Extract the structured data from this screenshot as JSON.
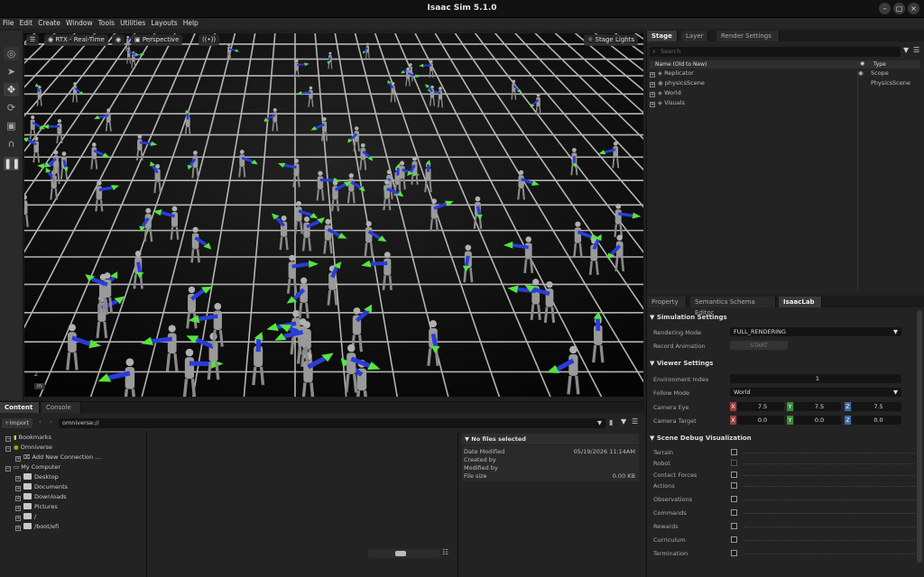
{
  "window": {
    "title": "Isaac Sim 5.1.0"
  },
  "menu": [
    "File",
    "Edit",
    "Create",
    "Window",
    "Tools",
    "Utilities",
    "Layouts",
    "Help"
  ],
  "viewport_toolbar": {
    "renderer": "RTX - Real-Time",
    "camera": "Perspective",
    "lights": "Stage Lights",
    "axis_label": "m"
  },
  "stage": {
    "tabs": [
      "Stage",
      "Layer",
      "Render Settings"
    ],
    "search_placeholder": "Search",
    "col_name": "Name (Old to New)",
    "col_type": "Type",
    "rows": [
      {
        "name": "Replicator",
        "type": "Scope"
      },
      {
        "name": "physicsScene",
        "type": "PhysicsScene"
      },
      {
        "name": "World",
        "type": ""
      },
      {
        "name": "Visuals",
        "type": ""
      }
    ]
  },
  "property": {
    "tabs": [
      "Property",
      "Semantics Schema Editor",
      "IsaacLab"
    ],
    "sim_settings": "Simulation Settings",
    "rendering_mode_label": "Rendering Mode",
    "rendering_mode_value": "FULL_RENDERING",
    "record_label": "Record Animation",
    "record_btn": "START",
    "viewer_settings": "Viewer Settings",
    "env_index_label": "Environment Index",
    "env_index_value": "1",
    "follow_label": "Follow Mode",
    "follow_value": "World",
    "cam_eye_label": "Camera Eye",
    "cam_eye": [
      "7.5",
      "7.5",
      "7.5"
    ],
    "cam_target_label": "Camera Target",
    "cam_target": [
      "0.0",
      "0.0",
      "0.0"
    ],
    "axes": [
      "X",
      "Y",
      "Z"
    ],
    "debug_viz": "Scene Debug Visualization",
    "debug_items": [
      "Terrain",
      "Robot",
      "Contact Forces",
      "Actions",
      "Observations",
      "Commands",
      "Rewards",
      "Curriculum",
      "Termination"
    ]
  },
  "content": {
    "tabs": [
      "Content",
      "Console"
    ],
    "import_label": "Import",
    "path": "omniverse://",
    "tree": [
      {
        "label": "Bookmarks",
        "indent": 0
      },
      {
        "label": "Omniverse",
        "indent": 0
      },
      {
        "label": "Add New Connection ...",
        "indent": 1
      },
      {
        "label": "My Computer",
        "indent": 0
      },
      {
        "label": "Desktop",
        "indent": 1
      },
      {
        "label": "Documents",
        "indent": 1
      },
      {
        "label": "Downloads",
        "indent": 1
      },
      {
        "label": "Pictures",
        "indent": 1
      },
      {
        "label": "/",
        "indent": 1
      },
      {
        "label": "/boot/efi",
        "indent": 1
      }
    ],
    "details_title": "No files selected",
    "details": [
      {
        "k": "Date Modified",
        "v": "05/19/2026 11:14AM"
      },
      {
        "k": "Created by",
        "v": ""
      },
      {
        "k": "Modified by",
        "v": ""
      },
      {
        "k": "File size",
        "v": "0.00 KB"
      }
    ]
  },
  "colors": {
    "arrow_green": "#55e63c",
    "arrow_blue": "#2a3cd8",
    "grid": "#d8d8d8",
    "robot": "#9a9a9a"
  }
}
